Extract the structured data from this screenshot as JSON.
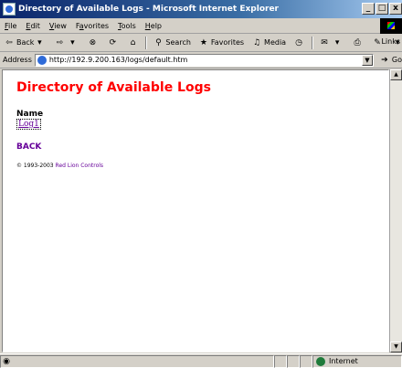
{
  "window": {
    "title": "Directory of Available Logs - Microsoft Internet Explorer",
    "controls": {
      "minimize": "_",
      "maximize": "□",
      "close": "x"
    }
  },
  "menubar": {
    "items": [
      {
        "label": "File",
        "key": "F",
        "rest": "ile"
      },
      {
        "label": "Edit",
        "key": "E",
        "rest": "dit"
      },
      {
        "label": "View",
        "key": "V",
        "rest": "iew"
      },
      {
        "label": "Favorites",
        "key": "a",
        "pre": "F",
        "rest": "vorites"
      },
      {
        "label": "Tools",
        "key": "T",
        "rest": "ools"
      },
      {
        "label": "Help",
        "key": "H",
        "rest": "elp"
      }
    ]
  },
  "toolbar": {
    "back_label": "Back",
    "search_label": "Search",
    "favorites_label": "Favorites",
    "media_label": "Media",
    "links_label": "Links"
  },
  "address": {
    "label": "Address",
    "url": "http://192.9.200.163/logs/default.htm",
    "go_label": "Go"
  },
  "page": {
    "title": "Directory of Available Logs",
    "column_header": "Name",
    "logs": [
      "Log1"
    ],
    "back_link": "BACK",
    "copyright_prefix": "© 1993-2003",
    "copyright_company": "Red Lion Controls"
  },
  "status": {
    "zone_label": "Internet"
  },
  "colors": {
    "title_red": "#ff0000",
    "link_purple": "#660099"
  }
}
